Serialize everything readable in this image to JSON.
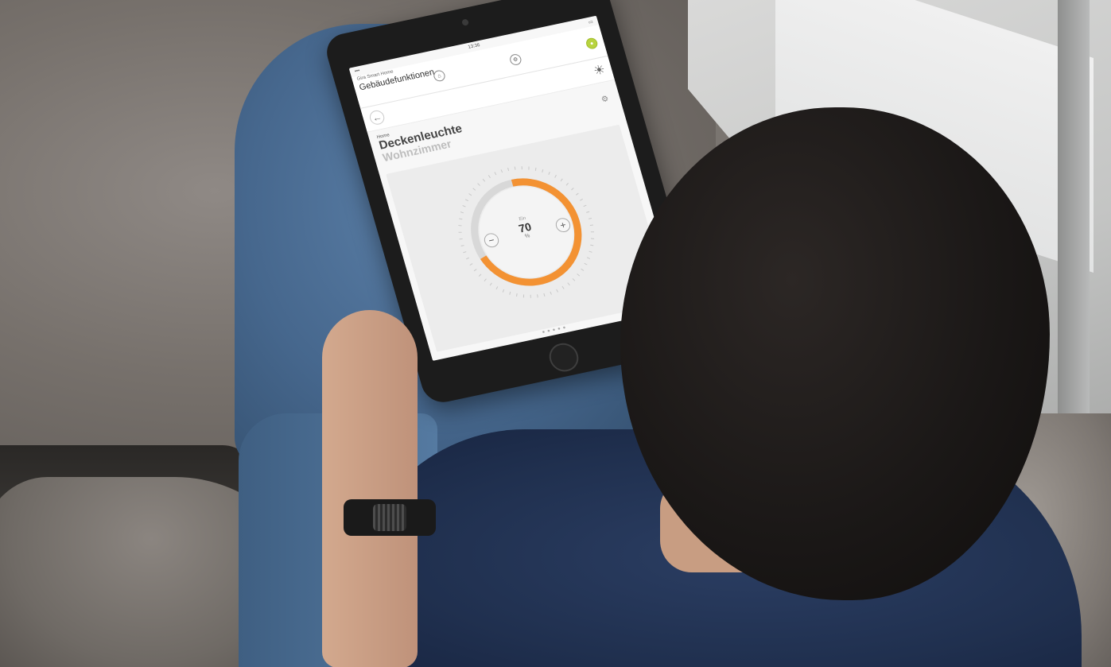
{
  "app": {
    "name": "Gira Smart Home",
    "time": "13:36",
    "page_heading": "Gebäudefunktionen"
  },
  "header_icons": [
    "home-icon",
    "settings-icon",
    "status-icon"
  ],
  "nav": {
    "back_icon": "←",
    "bulb_icon": "lightbulb-icon"
  },
  "device": {
    "breadcrumb": "Home",
    "name": "Deckenleuchte",
    "room": "Wohnzimmer"
  },
  "dimmer": {
    "state": "Ein",
    "value": "70",
    "unit": "%",
    "level": 0.7,
    "minus_label": "−",
    "plus_label": "+",
    "accent_color": "#f39233"
  }
}
